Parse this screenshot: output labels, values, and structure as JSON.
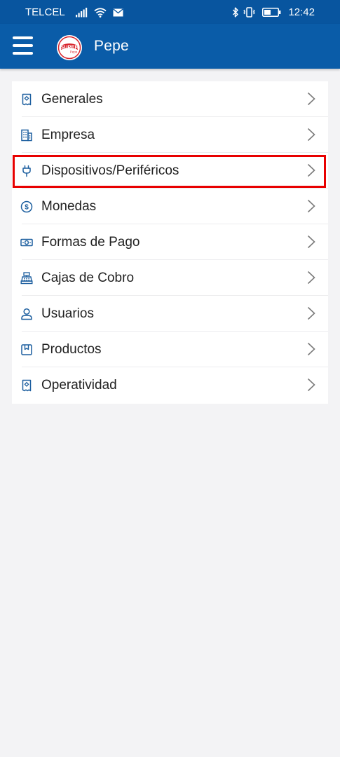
{
  "status_bar": {
    "carrier": "TELCEL",
    "time": "12:42",
    "icons": [
      "signal-icon",
      "wifi-icon",
      "mail-icon",
      "bluetooth-icon",
      "vibrate-icon",
      "battery-icon"
    ]
  },
  "app_bar": {
    "title": "Pepe",
    "logo_text": "SUPER",
    "logo_subtext": "Pepe",
    "menu_icon": "hamburger-icon"
  },
  "menu": {
    "items": [
      {
        "label": "Generales",
        "icon": "receipt-icon"
      },
      {
        "label": "Empresa",
        "icon": "building-icon"
      },
      {
        "label": "Dispositivos/Periféricos",
        "icon": "plug-icon",
        "highlighted": true
      },
      {
        "label": "Monedas",
        "icon": "dollar-coin-icon"
      },
      {
        "label": "Formas de Pago",
        "icon": "banknote-icon"
      },
      {
        "label": "Cajas de Cobro",
        "icon": "cash-register-icon"
      },
      {
        "label": "Usuarios",
        "icon": "user-icon"
      },
      {
        "label": "Productos",
        "icon": "product-box-icon"
      },
      {
        "label": "Operatividad",
        "icon": "receipt-icon"
      }
    ]
  },
  "colors": {
    "primary": "#0a5ca8",
    "status_bar": "#08559f",
    "icon": "#1d5f9f",
    "background": "#f3f3f5",
    "highlight": "#e80000",
    "chevron": "#7a7a7a"
  }
}
